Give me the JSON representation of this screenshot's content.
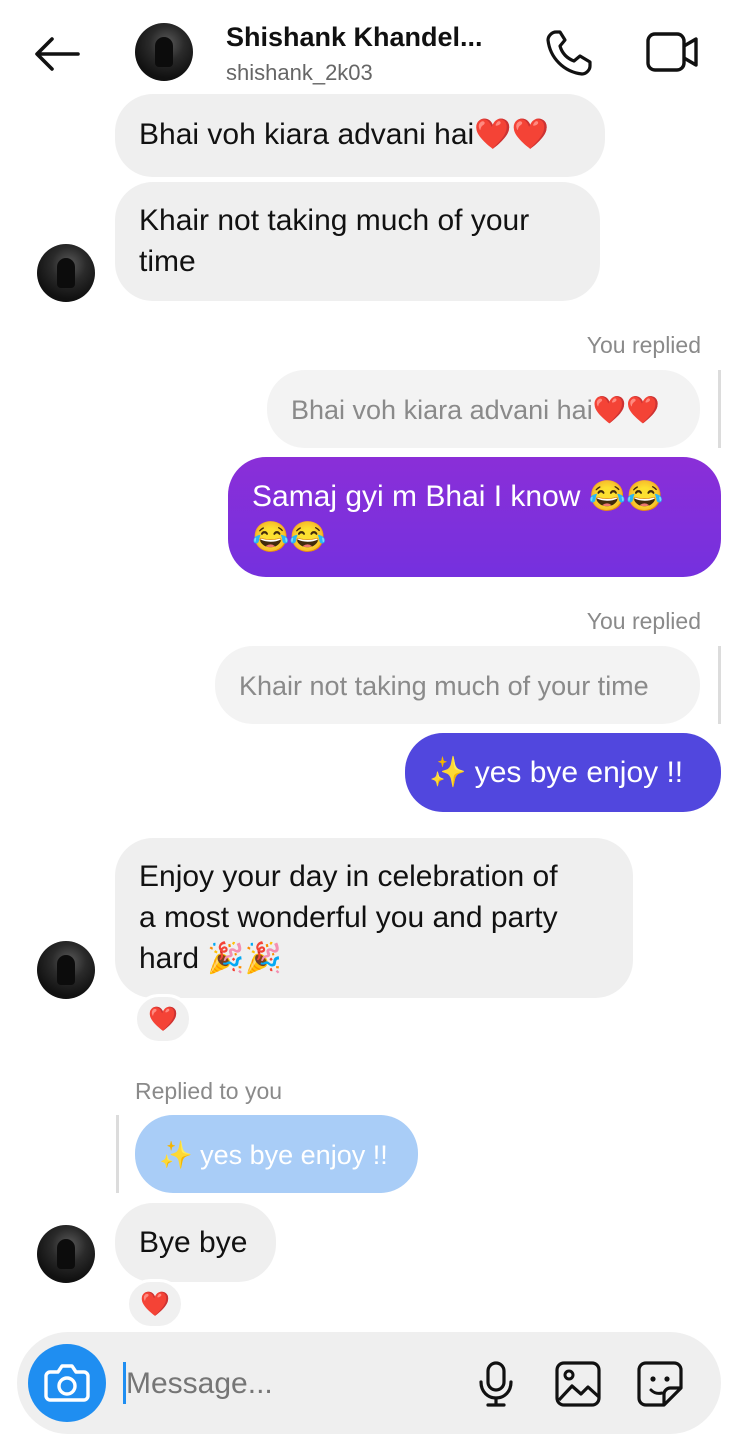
{
  "header": {
    "name": "Shishank Khandel...",
    "username": "shishank_2k03"
  },
  "messages": {
    "m1": "Bhai voh kiara advani hai❤️❤️",
    "m2_line1": "Khair not taking much of your",
    "m2_line2": "time",
    "label1": "You replied",
    "quote1": "Bhai voh kiara advani hai❤️❤️",
    "m3_line1": "Samaj gyi m Bhai I know 😂😂",
    "m3_line2": "😂😂",
    "label2": "You replied",
    "quote2": "Khair not taking much of your time",
    "m4": "✨ yes bye enjoy !!",
    "m5_line1": "Enjoy your day in celebration of",
    "m5_line2": "a most wonderful you and party",
    "m5_line3": "hard 🎉🎉",
    "react1": "❤️",
    "label3": "Replied to you",
    "quote3": "✨ yes bye enjoy !!",
    "m6": "Bye bye",
    "react2": "❤️"
  },
  "composer": {
    "placeholder": "Message..."
  },
  "colors": {
    "accent": "#1f8ef1",
    "bubble_purple": "#7f2fd9",
    "bubble_indigo": "#5147de",
    "quote_blue": "#a9cdf7",
    "incoming": "#efefef"
  }
}
